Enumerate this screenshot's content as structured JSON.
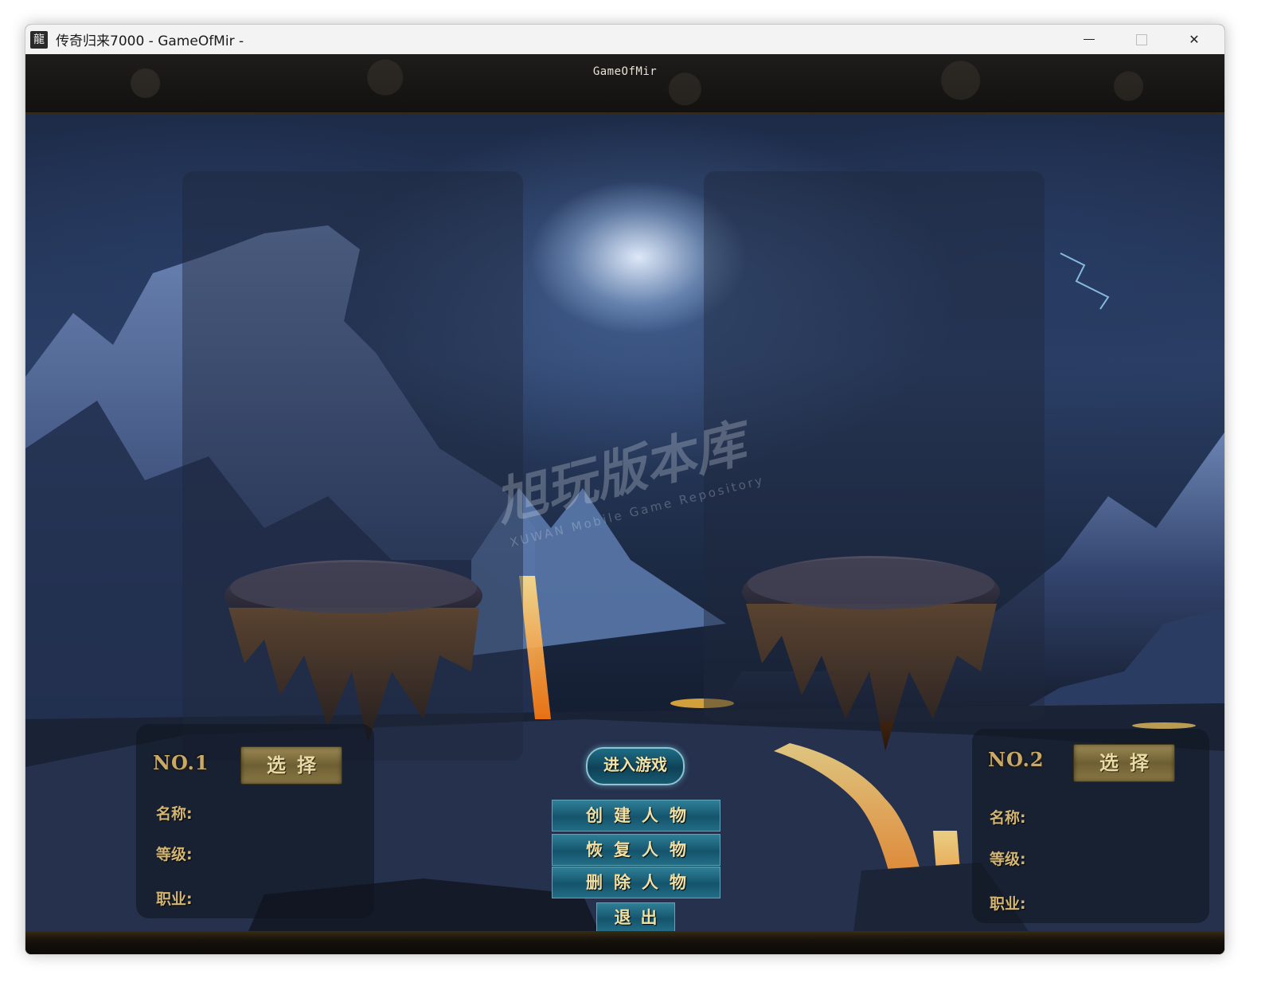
{
  "window": {
    "app_icon": "龍",
    "title": "传奇归来7000 - GameOfMir -",
    "controls": {
      "minimize": "minimize-icon",
      "maximize": "maximize-icon",
      "close": "✕"
    }
  },
  "game": {
    "header_title": "GameOfMir",
    "slot1": {
      "label": "NO.1",
      "select": "选择",
      "name_label": "名称:",
      "level_label": "等级:",
      "job_label": "职业:",
      "name_value": "",
      "level_value": "",
      "job_value": ""
    },
    "slot2": {
      "label": "NO.2",
      "select": "选择",
      "name_label": "名称:",
      "level_label": "等级:",
      "job_label": "职业:",
      "name_value": "",
      "level_value": "",
      "job_value": ""
    },
    "enter_game": "进入游戏",
    "menu": {
      "create": "创建人物",
      "restore": "恢复人物",
      "delete": "删除人物",
      "exit": "退出"
    },
    "watermark": "旭玩版本库",
    "watermark_sub": "XUWAN Mobile Game Repository"
  }
}
